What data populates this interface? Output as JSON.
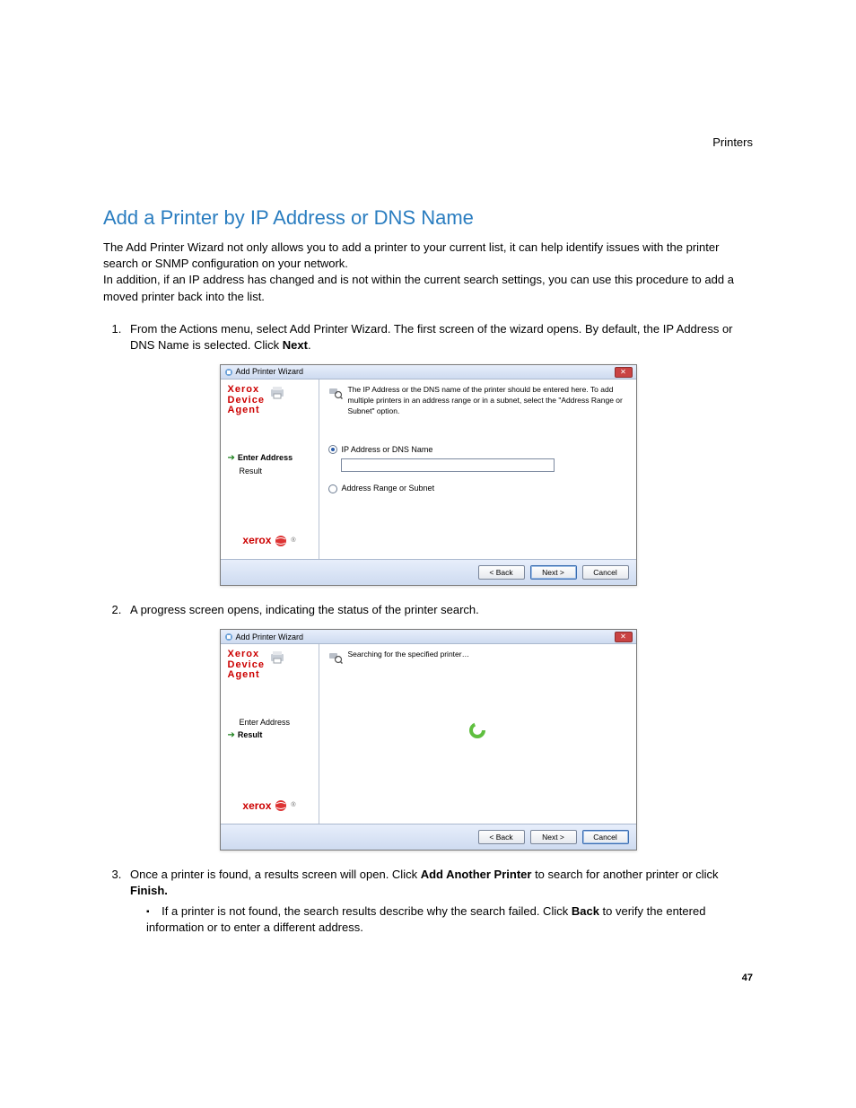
{
  "header": {
    "section": "Printers"
  },
  "title": "Add a Printer by IP Address or DNS Name",
  "intro_p1": "The Add Printer Wizard not only allows you to add a printer to your current list, it can help identify issues with the printer search or SNMP configuration on your network.",
  "intro_p2": "In addition, if an IP address has changed and is not within the current search settings, you can use this procedure to add a moved printer back into the list.",
  "steps": {
    "s1_pre": "From the Actions menu, select Add Printer Wizard. The first screen of the wizard opens. By default, the IP Address or DNS Name is selected. Click ",
    "s1_bold": "Next",
    "s1_post": ".",
    "s2": "A progress screen opens, indicating the status of the printer search.",
    "s3_pre": "Once a printer is found, a results screen will open. Click ",
    "s3_bold1": "Add Another Printer",
    "s3_mid": " to search for another printer or click ",
    "s3_bold2": "Finish.",
    "sub_pre": "If a printer is not found, the search results describe why the search failed. Click ",
    "sub_bold": "Back",
    "sub_post": " to verify the entered information or to enter a different address."
  },
  "wizard": {
    "title": "Add Printer Wizard",
    "brand_line1": "Xerox",
    "brand_line2": "Device",
    "brand_line3": "Agent",
    "step_enter": "Enter Address",
    "step_result": "Result",
    "desc": "The IP Address or the DNS name of the printer should be entered here. To add multiple printers in an address range or in a subnet, select the \"Address Range or Subnet\" option.",
    "radio_ip": "IP Address or DNS Name",
    "radio_range": "Address Range or Subnet",
    "searching": "Searching for the specified printer…",
    "xerox_word": "xerox",
    "btn_back": "< Back",
    "btn_next": "Next >",
    "btn_cancel": "Cancel"
  },
  "page_number": "47"
}
